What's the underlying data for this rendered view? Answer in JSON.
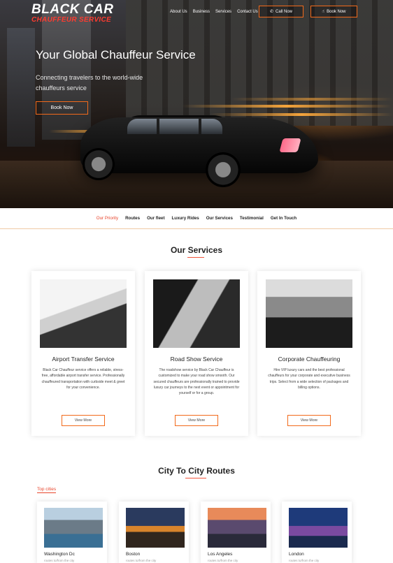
{
  "brand": {
    "name": "BLACK CAR",
    "tagline": "CHAUFFEUR SERVICE"
  },
  "nav": {
    "items": [
      "About Us",
      "Business",
      "Services",
      "Contact Us"
    ]
  },
  "header_buttons": {
    "call": "Call Now",
    "book": "Book Now"
  },
  "hero": {
    "title": "Your Global Chauffeur Service",
    "subtitle": "Connecting travelers to the world-wide chauffeurs service",
    "button": "Book Now"
  },
  "subnav": {
    "items": [
      "Our Priority",
      "Routes",
      "Our fleet",
      "Luxury Rides",
      "Our Services",
      "Testimonial",
      "Get In Touch"
    ],
    "active": "Our Priority"
  },
  "services": {
    "title": "Our Services",
    "cards": [
      {
        "title": "Airport Transfer Service",
        "desc": "Black Car Chauffeur service offers a reliable, stress-free, affordable airport transfer service. Professionally chauffeured transportation with curbside meet & greet for your convenience.",
        "button": "View More"
      },
      {
        "title": "Road Show Service",
        "desc": "The roadshow service by Black Car Chauffeur is customized to make your road show smooth. Our secured chauffeurs are professionally trained to provide luxury car journeys to the next event or appointment for yourself or for a group.",
        "button": "View More"
      },
      {
        "title": "Corporate Chauffeuring",
        "desc": "Hire VIP luxury cars and the best professional chauffeurs for your corporate and executive business trips. Select from a wide selection of packages and billing options.",
        "button": "View More"
      }
    ]
  },
  "routes": {
    "title": "City To City Routes",
    "tab": "Top cities",
    "cities": [
      {
        "name": "Washington Dc",
        "sub": "routes to/from the city"
      },
      {
        "name": "Boston",
        "sub": "routes to/from the city"
      },
      {
        "name": "Los Angeles",
        "sub": "routes to/from the city"
      },
      {
        "name": "London",
        "sub": "routes to/from the city"
      }
    ]
  },
  "colors": {
    "accent": "#f26a1b",
    "brand_red": "#ff3b2f",
    "active_link": "#e8452c"
  }
}
